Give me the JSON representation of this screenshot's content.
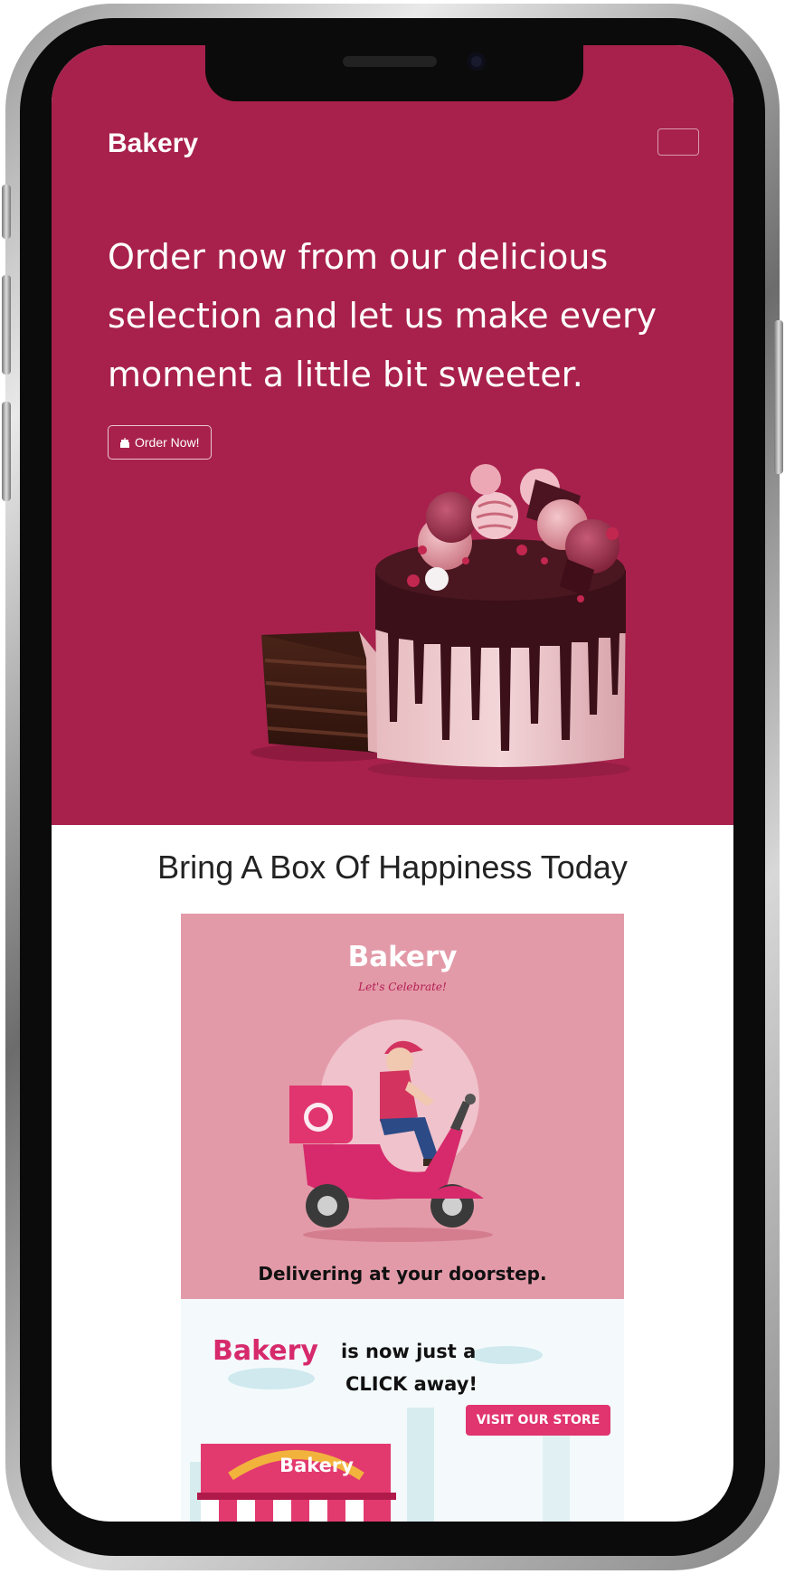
{
  "app": {
    "brand": "Bakery"
  },
  "hero": {
    "headline": "Order now from our delicious selection and let us make every moment a little bit sweeter.",
    "order_button": "Order Now!",
    "bg_color": "#a8214d"
  },
  "section": {
    "tagline": "Bring A Box Of Happiness Today"
  },
  "promo": {
    "brand": "Bakery",
    "subtitle": "Let's Celebrate!",
    "delivery_text": "Delivering at your doorstep.",
    "click_brand": "Bakery",
    "click_line1": "is now just a",
    "click_line2": "CLICK away!",
    "visit_button": "VISIT OUR STORE",
    "store_sign": "Bakery",
    "accent_color": "#e0356f",
    "pink_bg": "#e39aa8"
  },
  "icons": [
    "menu-toggle-icon",
    "cake-icon",
    "camera-icon"
  ]
}
